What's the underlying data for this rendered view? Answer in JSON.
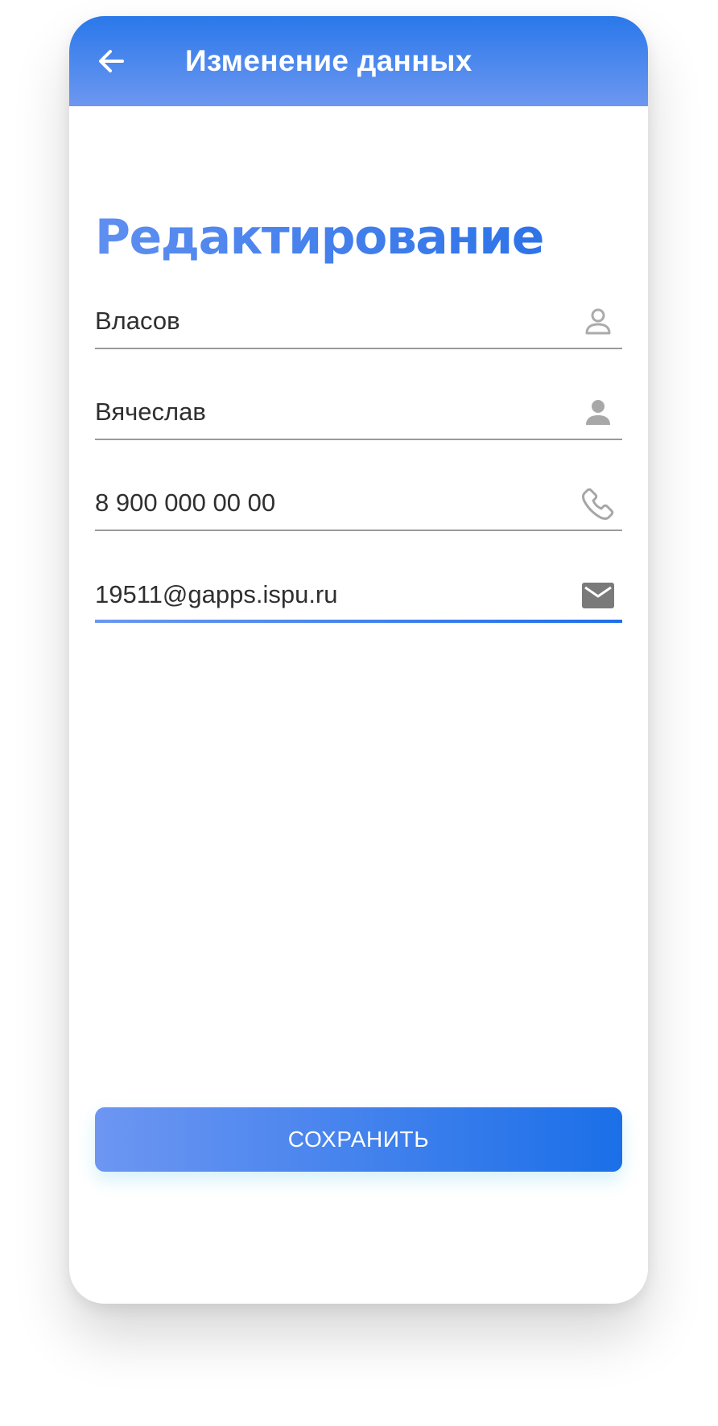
{
  "app_bar": {
    "title": "Изменение данных",
    "back_icon": "arrow-left-icon"
  },
  "heading": "Редактирование",
  "fields": [
    {
      "value": "Власов",
      "icon": "person-outline-icon",
      "active": false
    },
    {
      "value": "Вячеслав",
      "icon": "person-filled-icon",
      "active": false
    },
    {
      "value": "8 900 000 00 00",
      "icon": "phone-icon",
      "active": false
    },
    {
      "value": "19511@gapps.ispu.ru",
      "icon": "mail-icon",
      "active": true
    }
  ],
  "save_button": {
    "label": "СОХРАНИТЬ"
  },
  "colors": {
    "accent": "#2d73e8",
    "accent_light": "#6d97f0",
    "text": "#2f2f2f",
    "icon_gray": "#9e9e9e"
  }
}
